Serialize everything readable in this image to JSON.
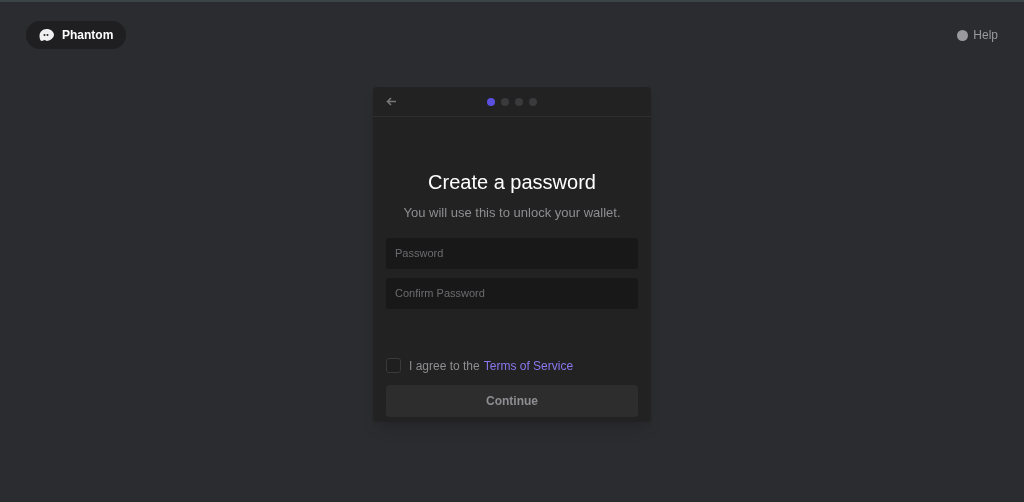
{
  "brand": {
    "name": "Phantom"
  },
  "help": {
    "label": "Help"
  },
  "steps": [
    {
      "selected": true
    },
    {
      "selected": false
    },
    {
      "selected": false
    },
    {
      "selected": false
    }
  ],
  "title": "Create a password",
  "subtitle": "You will use this to unlock your wallet.",
  "fields": [
    {
      "placeholder": "Password"
    },
    {
      "placeholder": "Confirm Password"
    }
  ],
  "agree": {
    "text": "I agree to the",
    "link": "Terms of Service",
    "checked": false
  },
  "continue_button": {
    "label": "Continue",
    "disabled": true
  }
}
